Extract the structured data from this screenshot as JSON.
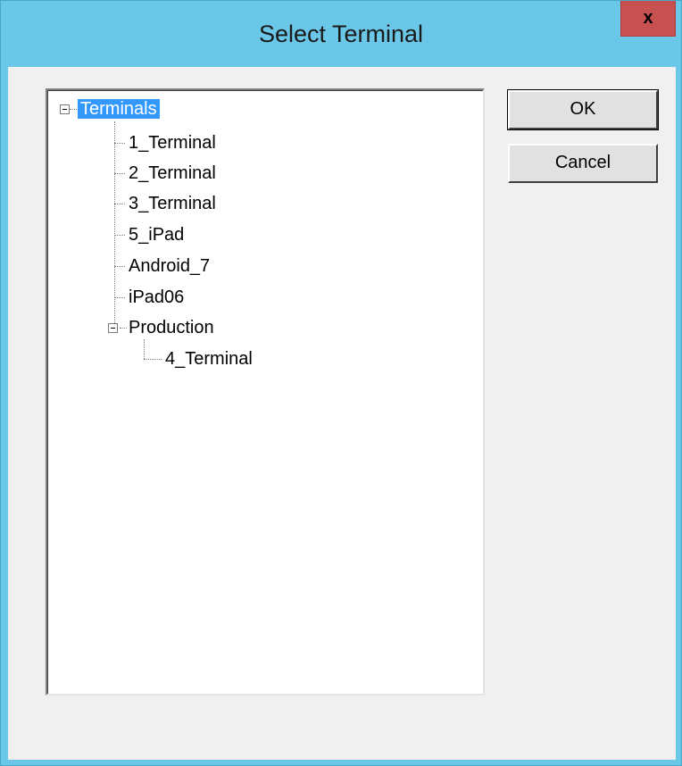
{
  "dialog": {
    "title": "Select Terminal",
    "close_label": "x"
  },
  "tree": {
    "root": "Terminals",
    "items": [
      "1_Terminal",
      "2_Terminal",
      "3_Terminal",
      "5_iPad",
      "Android_7",
      "iPad06"
    ],
    "group": {
      "label": "Production",
      "children": [
        "4_Terminal"
      ]
    }
  },
  "buttons": {
    "ok": "OK",
    "cancel": "Cancel"
  },
  "colors": {
    "titlebar": "#6bc7e8",
    "selection": "#3399ff",
    "close": "#c75050"
  }
}
